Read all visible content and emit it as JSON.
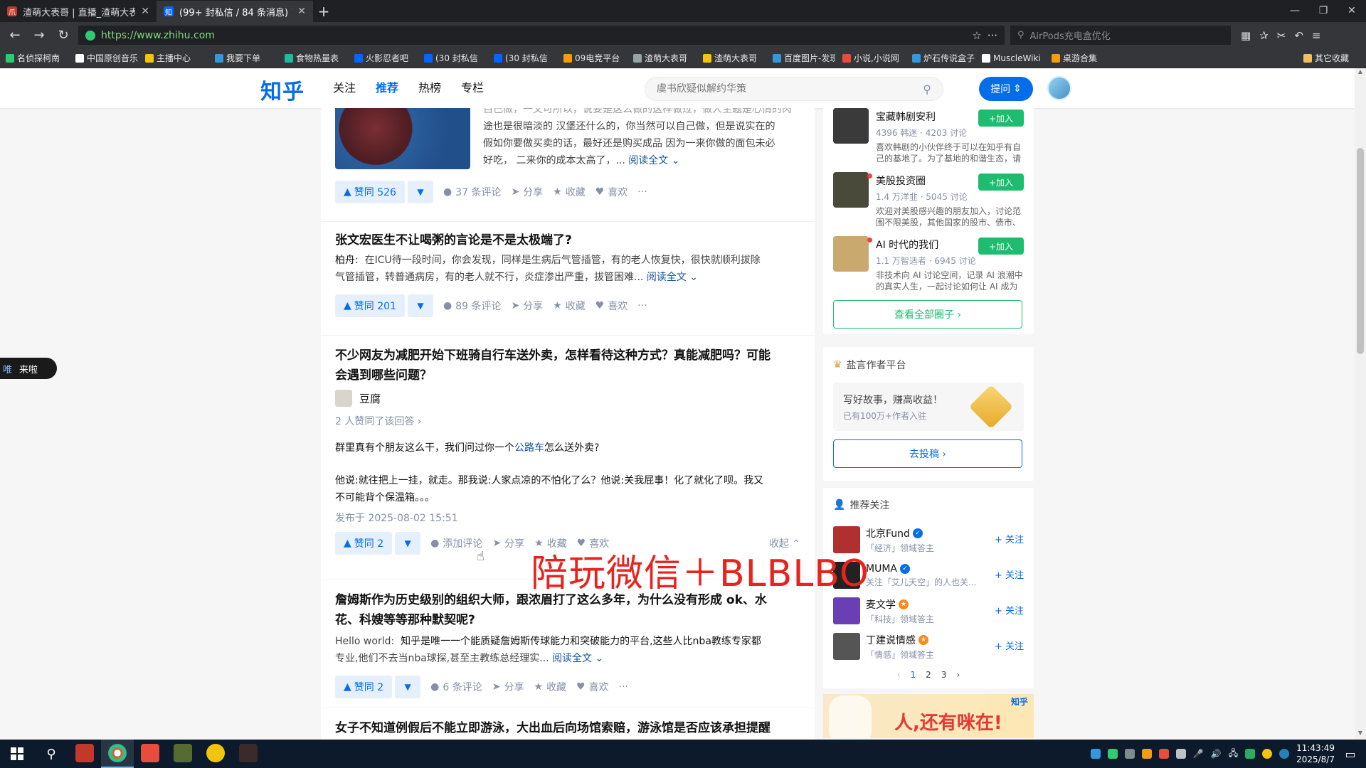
{
  "browser": {
    "tabs": [
      {
        "title": "渣萌大表哥 | 直播_渣萌大表哥...",
        "favicon": "爪",
        "active": false
      },
      {
        "title": "(99+ 封私信 / 84 条消息) 首页...",
        "favicon": "知",
        "active": true
      }
    ],
    "new_tab": "+",
    "url": "https://www.zhihu.com",
    "search_placeholder": "AirPods充电盒优化",
    "bookmarks": [
      {
        "label": "名侦探柯南",
        "color": "#2ecc71"
      },
      {
        "label": "中国原创音乐",
        "color": "#ffffff"
      },
      {
        "label": "主播中心",
        "color": "#f1c40f"
      },
      {
        "label": "我要下单",
        "color": "#3498db"
      },
      {
        "label": "食物热量表",
        "color": "#1abc9c"
      },
      {
        "label": "火影忍者吧",
        "color": "#0066ff"
      },
      {
        "label": "(30 封私信",
        "color": "#0066ff"
      },
      {
        "label": "(30 封私信",
        "color": "#0066ff"
      },
      {
        "label": "09电竞平台",
        "color": "#f39c12"
      },
      {
        "label": "渣萌大表哥",
        "color": "#95a5a6"
      },
      {
        "label": "渣萌大表哥",
        "color": "#f1c40f"
      },
      {
        "label": "百度图片-发现",
        "color": "#3498db"
      },
      {
        "label": "小说,小说网",
        "color": "#e74c3c"
      },
      {
        "label": "炉石传说盒子",
        "color": "#3498db"
      },
      {
        "label": "MuscleWiki",
        "color": "#ffffff"
      },
      {
        "label": "桌游合集",
        "color": "#f39c12"
      }
    ],
    "other_bookmarks": "其它收藏"
  },
  "header": {
    "logo": "知乎",
    "nav": [
      "关注",
      "推荐",
      "热榜",
      "专栏"
    ],
    "active_nav": "推荐",
    "search_placeholder": "虞书欣疑似解约华策",
    "ask_button": "提问"
  },
  "feed": [
    {
      "title": "",
      "excerpt_lines": [
        "自己做，一文可所以，说要是这么做的这样做过，做人主题是心情的肉",
        "途也是很暗淡的 汉堡还什么的，你当然可以自己做，但是说实在的",
        "假如你要做买卖的话，最好还是购买成品 因为一来你做的面包未必",
        "好吃，  二来你的成本太高了，..."
      ],
      "read_more": "阅读全文",
      "upvote": "赞同 526",
      "comments": "37 条评论",
      "share": "分享",
      "collect": "收藏",
      "like": "喜欢",
      "more": "···"
    },
    {
      "title": "张文宏医生不让喝粥的言论是不是太极端了?",
      "author": "柏舟:",
      "excerpt_lines": [
        "在ICU待一段时间，你会发现，同样是生病后气管插管，有的老人恢复快，很快就顺利拔除",
        "气管插管，转普通病房，有的老人就不行，炎症渗出严重，拔管困难..."
      ],
      "read_more": "阅读全文",
      "upvote": "赞同 201",
      "comments": "89 条评论",
      "share": "分享",
      "collect": "收藏",
      "like": "喜欢",
      "more": "···"
    },
    {
      "title_lines": [
        "不少网友为减肥开始下班骑自行车送外卖，怎样看待这种方式？真能减肥吗？可能",
        "会遇到哪些问题？"
      ],
      "author": "豆腐",
      "voters": "2 人赞同了该回答 ›",
      "para1_pre": "群里真有个朋友这么干，我们问过你一个",
      "para1_link": "公路车",
      "para1_post": "怎么送外卖?",
      "para2_lines": [
        "他说:就往把上一挂，就走。那我说:人家点凉的不怕化了么？他说:关我屁事！化了就化了呗。我又",
        "不可能背个保温箱。。。"
      ],
      "published": "发布于 2025-08-02 15:51",
      "upvote": "赞同 2",
      "comments": "添加评论",
      "share": "分享",
      "collect": "收藏",
      "like": "喜欢",
      "collapse": "收起 ⌃"
    },
    {
      "title_lines": [
        "詹姆斯作为历史级别的组织大师，跟浓眉打了这么多年，为什么没有形成 ok、水",
        "花、科嫂等等那种默契呢?"
      ],
      "author": "Hello world:",
      "excerpt_lines": [
        "知乎是唯一一个能质疑詹姆斯传球能力和突破能力的平台,这些人比nba教练专家都",
        "专业,他们不去当nba球探,甚至主教练总经理实..."
      ],
      "read_more": "阅读全文",
      "upvote": "赞同 2",
      "comments": "6 条评论",
      "share": "分享",
      "collect": "收藏",
      "like": "喜欢",
      "more": "···"
    },
    {
      "title": "女子不知道例假后不能立即游泳，大出血后向场馆索赔，游泳馆是否应该承担提醒"
    }
  ],
  "side": {
    "circles": [
      {
        "name": "宝藏韩剧安利",
        "stat": "4396 韩迷 · 4203 讨论",
        "desc": "喜欢韩剧的小伙伴终于可以在知乎有自己的基地了。为了基地的和谐生态，请大...",
        "join": "+加入",
        "red_dot": false,
        "color": "#3a3a3a"
      },
      {
        "name": "美股投资圈",
        "stat": "1.4 万洋韭 · 5045 讨论",
        "desc": "欢迎对美股感兴趣的朋友加入，讨论范围不限美股，其他国家的股市、债市、大...",
        "join": "+加入",
        "red_dot": true,
        "color": "#4a4a3a"
      },
      {
        "name": "AI 时代的我们",
        "stat": "1.1 万智适者 · 6945 讨论",
        "desc": "非技术向 AI 讨论空间，记录 AI 浪潮中的真实人生，一起讨论如何让 AI 成为延伸...",
        "join": "+加入",
        "red_dot": true,
        "color": "#c9a96e"
      }
    ],
    "view_all": "查看全部圈子 ›",
    "creator_title": "盐言作者平台",
    "promo_title": "写好故事，赚高收益！",
    "promo_sub": "已有100万+作者入驻",
    "submit": "去投稿 ›",
    "recommend_title": "推荐关注",
    "recommend": [
      {
        "name": "北京Fund",
        "badge": "blue",
        "desc": "「经济」领域答主",
        "follow": "+ 关注",
        "color": "#b03030"
      },
      {
        "name": "MUMA",
        "badge": "blue",
        "desc": "关注「艾儿天空」的人也关...",
        "follow": "+ 关注",
        "color": "#222222"
      },
      {
        "name": "麦文学",
        "badge": "orange",
        "desc": "「科技」领域答主",
        "follow": "+ 关注",
        "color": "#6a3fb5"
      },
      {
        "name": "丁建说情感",
        "badge": "orange",
        "desc": "「情感」领域答主",
        "follow": "+ 关注",
        "color": "#555555"
      }
    ],
    "pager": [
      "‹",
      "1",
      "2",
      "3",
      "›"
    ],
    "banner_text": "人,还有咪在!",
    "banner_brand": "知乎"
  },
  "float_pill": {
    "left": "唯",
    "text": "来啦"
  },
  "overlay_text": "陪玩微信＋BLBLBO",
  "taskbar": {
    "time": "11:43:49",
    "date": "2025/8/7"
  }
}
